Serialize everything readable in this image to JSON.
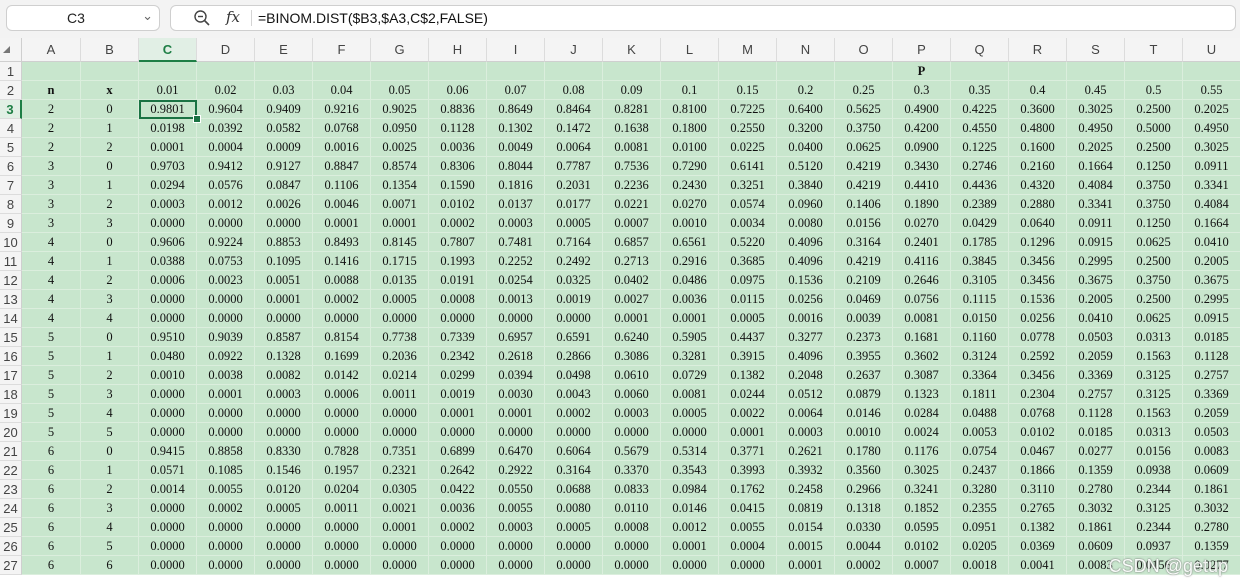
{
  "formula_bar": {
    "name_box": "C3",
    "formula": "=BINOM.DIST($B3,$A3,C$2,FALSE)"
  },
  "selected": {
    "col": 2,
    "row": 2
  },
  "columns": [
    "A",
    "B",
    "C",
    "D",
    "E",
    "F",
    "G",
    "H",
    "I",
    "J",
    "K",
    "L",
    "M",
    "N",
    "O",
    "P",
    "Q",
    "R",
    "S",
    "T",
    "U"
  ],
  "rows": [
    [
      "",
      "",
      "",
      "",
      "",
      "",
      "",
      "",
      "",
      "",
      "",
      "",
      "",
      "",
      "",
      "P",
      "",
      "",
      "",
      "",
      ""
    ],
    [
      "n",
      "x",
      "0.01",
      "0.02",
      "0.03",
      "0.04",
      "0.05",
      "0.06",
      "0.07",
      "0.08",
      "0.09",
      "0.1",
      "0.15",
      "0.2",
      "0.25",
      "0.3",
      "0.35",
      "0.4",
      "0.45",
      "0.5",
      "0.55"
    ],
    [
      "2",
      "0",
      "0.9801",
      "0.9604",
      "0.9409",
      "0.9216",
      "0.9025",
      "0.8836",
      "0.8649",
      "0.8464",
      "0.8281",
      "0.8100",
      "0.7225",
      "0.6400",
      "0.5625",
      "0.4900",
      "0.4225",
      "0.3600",
      "0.3025",
      "0.2500",
      "0.2025"
    ],
    [
      "2",
      "1",
      "0.0198",
      "0.0392",
      "0.0582",
      "0.0768",
      "0.0950",
      "0.1128",
      "0.1302",
      "0.1472",
      "0.1638",
      "0.1800",
      "0.2550",
      "0.3200",
      "0.3750",
      "0.4200",
      "0.4550",
      "0.4800",
      "0.4950",
      "0.5000",
      "0.4950"
    ],
    [
      "2",
      "2",
      "0.0001",
      "0.0004",
      "0.0009",
      "0.0016",
      "0.0025",
      "0.0036",
      "0.0049",
      "0.0064",
      "0.0081",
      "0.0100",
      "0.0225",
      "0.0400",
      "0.0625",
      "0.0900",
      "0.1225",
      "0.1600",
      "0.2025",
      "0.2500",
      "0.3025"
    ],
    [
      "3",
      "0",
      "0.9703",
      "0.9412",
      "0.9127",
      "0.8847",
      "0.8574",
      "0.8306",
      "0.8044",
      "0.7787",
      "0.7536",
      "0.7290",
      "0.6141",
      "0.5120",
      "0.4219",
      "0.3430",
      "0.2746",
      "0.2160",
      "0.1664",
      "0.1250",
      "0.0911"
    ],
    [
      "3",
      "1",
      "0.0294",
      "0.0576",
      "0.0847",
      "0.1106",
      "0.1354",
      "0.1590",
      "0.1816",
      "0.2031",
      "0.2236",
      "0.2430",
      "0.3251",
      "0.3840",
      "0.4219",
      "0.4410",
      "0.4436",
      "0.4320",
      "0.4084",
      "0.3750",
      "0.3341"
    ],
    [
      "3",
      "2",
      "0.0003",
      "0.0012",
      "0.0026",
      "0.0046",
      "0.0071",
      "0.0102",
      "0.0137",
      "0.0177",
      "0.0221",
      "0.0270",
      "0.0574",
      "0.0960",
      "0.1406",
      "0.1890",
      "0.2389",
      "0.2880",
      "0.3341",
      "0.3750",
      "0.4084"
    ],
    [
      "3",
      "3",
      "0.0000",
      "0.0000",
      "0.0000",
      "0.0001",
      "0.0001",
      "0.0002",
      "0.0003",
      "0.0005",
      "0.0007",
      "0.0010",
      "0.0034",
      "0.0080",
      "0.0156",
      "0.0270",
      "0.0429",
      "0.0640",
      "0.0911",
      "0.1250",
      "0.1664"
    ],
    [
      "4",
      "0",
      "0.9606",
      "0.9224",
      "0.8853",
      "0.8493",
      "0.8145",
      "0.7807",
      "0.7481",
      "0.7164",
      "0.6857",
      "0.6561",
      "0.5220",
      "0.4096",
      "0.3164",
      "0.2401",
      "0.1785",
      "0.1296",
      "0.0915",
      "0.0625",
      "0.0410"
    ],
    [
      "4",
      "1",
      "0.0388",
      "0.0753",
      "0.1095",
      "0.1416",
      "0.1715",
      "0.1993",
      "0.2252",
      "0.2492",
      "0.2713",
      "0.2916",
      "0.3685",
      "0.4096",
      "0.4219",
      "0.4116",
      "0.3845",
      "0.3456",
      "0.2995",
      "0.2500",
      "0.2005"
    ],
    [
      "4",
      "2",
      "0.0006",
      "0.0023",
      "0.0051",
      "0.0088",
      "0.0135",
      "0.0191",
      "0.0254",
      "0.0325",
      "0.0402",
      "0.0486",
      "0.0975",
      "0.1536",
      "0.2109",
      "0.2646",
      "0.3105",
      "0.3456",
      "0.3675",
      "0.3750",
      "0.3675"
    ],
    [
      "4",
      "3",
      "0.0000",
      "0.0000",
      "0.0001",
      "0.0002",
      "0.0005",
      "0.0008",
      "0.0013",
      "0.0019",
      "0.0027",
      "0.0036",
      "0.0115",
      "0.0256",
      "0.0469",
      "0.0756",
      "0.1115",
      "0.1536",
      "0.2005",
      "0.2500",
      "0.2995"
    ],
    [
      "4",
      "4",
      "0.0000",
      "0.0000",
      "0.0000",
      "0.0000",
      "0.0000",
      "0.0000",
      "0.0000",
      "0.0000",
      "0.0001",
      "0.0001",
      "0.0005",
      "0.0016",
      "0.0039",
      "0.0081",
      "0.0150",
      "0.0256",
      "0.0410",
      "0.0625",
      "0.0915"
    ],
    [
      "5",
      "0",
      "0.9510",
      "0.9039",
      "0.8587",
      "0.8154",
      "0.7738",
      "0.7339",
      "0.6957",
      "0.6591",
      "0.6240",
      "0.5905",
      "0.4437",
      "0.3277",
      "0.2373",
      "0.1681",
      "0.1160",
      "0.0778",
      "0.0503",
      "0.0313",
      "0.0185"
    ],
    [
      "5",
      "1",
      "0.0480",
      "0.0922",
      "0.1328",
      "0.1699",
      "0.2036",
      "0.2342",
      "0.2618",
      "0.2866",
      "0.3086",
      "0.3281",
      "0.3915",
      "0.4096",
      "0.3955",
      "0.3602",
      "0.3124",
      "0.2592",
      "0.2059",
      "0.1563",
      "0.1128"
    ],
    [
      "5",
      "2",
      "0.0010",
      "0.0038",
      "0.0082",
      "0.0142",
      "0.0214",
      "0.0299",
      "0.0394",
      "0.0498",
      "0.0610",
      "0.0729",
      "0.1382",
      "0.2048",
      "0.2637",
      "0.3087",
      "0.3364",
      "0.3456",
      "0.3369",
      "0.3125",
      "0.2757"
    ],
    [
      "5",
      "3",
      "0.0000",
      "0.0001",
      "0.0003",
      "0.0006",
      "0.0011",
      "0.0019",
      "0.0030",
      "0.0043",
      "0.0060",
      "0.0081",
      "0.0244",
      "0.0512",
      "0.0879",
      "0.1323",
      "0.1811",
      "0.2304",
      "0.2757",
      "0.3125",
      "0.3369"
    ],
    [
      "5",
      "4",
      "0.0000",
      "0.0000",
      "0.0000",
      "0.0000",
      "0.0000",
      "0.0001",
      "0.0001",
      "0.0002",
      "0.0003",
      "0.0005",
      "0.0022",
      "0.0064",
      "0.0146",
      "0.0284",
      "0.0488",
      "0.0768",
      "0.1128",
      "0.1563",
      "0.2059"
    ],
    [
      "5",
      "5",
      "0.0000",
      "0.0000",
      "0.0000",
      "0.0000",
      "0.0000",
      "0.0000",
      "0.0000",
      "0.0000",
      "0.0000",
      "0.0000",
      "0.0001",
      "0.0003",
      "0.0010",
      "0.0024",
      "0.0053",
      "0.0102",
      "0.0185",
      "0.0313",
      "0.0503"
    ],
    [
      "6",
      "0",
      "0.9415",
      "0.8858",
      "0.8330",
      "0.7828",
      "0.7351",
      "0.6899",
      "0.6470",
      "0.6064",
      "0.5679",
      "0.5314",
      "0.3771",
      "0.2621",
      "0.1780",
      "0.1176",
      "0.0754",
      "0.0467",
      "0.0277",
      "0.0156",
      "0.0083"
    ],
    [
      "6",
      "1",
      "0.0571",
      "0.1085",
      "0.1546",
      "0.1957",
      "0.2321",
      "0.2642",
      "0.2922",
      "0.3164",
      "0.3370",
      "0.3543",
      "0.3993",
      "0.3932",
      "0.3560",
      "0.3025",
      "0.2437",
      "0.1866",
      "0.1359",
      "0.0938",
      "0.0609"
    ],
    [
      "6",
      "2",
      "0.0014",
      "0.0055",
      "0.0120",
      "0.0204",
      "0.0305",
      "0.0422",
      "0.0550",
      "0.0688",
      "0.0833",
      "0.0984",
      "0.1762",
      "0.2458",
      "0.2966",
      "0.3241",
      "0.3280",
      "0.3110",
      "0.2780",
      "0.2344",
      "0.1861"
    ],
    [
      "6",
      "3",
      "0.0000",
      "0.0002",
      "0.0005",
      "0.0011",
      "0.0021",
      "0.0036",
      "0.0055",
      "0.0080",
      "0.0110",
      "0.0146",
      "0.0415",
      "0.0819",
      "0.1318",
      "0.1852",
      "0.2355",
      "0.2765",
      "0.3032",
      "0.3125",
      "0.3032"
    ],
    [
      "6",
      "4",
      "0.0000",
      "0.0000",
      "0.0000",
      "0.0000",
      "0.0001",
      "0.0002",
      "0.0003",
      "0.0005",
      "0.0008",
      "0.0012",
      "0.0055",
      "0.0154",
      "0.0330",
      "0.0595",
      "0.0951",
      "0.1382",
      "0.1861",
      "0.2344",
      "0.2780"
    ],
    [
      "6",
      "5",
      "0.0000",
      "0.0000",
      "0.0000",
      "0.0000",
      "0.0000",
      "0.0000",
      "0.0000",
      "0.0000",
      "0.0000",
      "0.0001",
      "0.0004",
      "0.0015",
      "0.0044",
      "0.0102",
      "0.0205",
      "0.0369",
      "0.0609",
      "0.0937",
      "0.1359"
    ],
    [
      "6",
      "6",
      "0.0000",
      "0.0000",
      "0.0000",
      "0.0000",
      "0.0000",
      "0.0000",
      "0.0000",
      "0.0000",
      "0.0000",
      "0.0000",
      "0.0000",
      "0.0001",
      "0.0002",
      "0.0007",
      "0.0018",
      "0.0041",
      "0.0083",
      "0.0156",
      "0.0277"
    ]
  ],
  "watermark": "CSDN @getup"
}
